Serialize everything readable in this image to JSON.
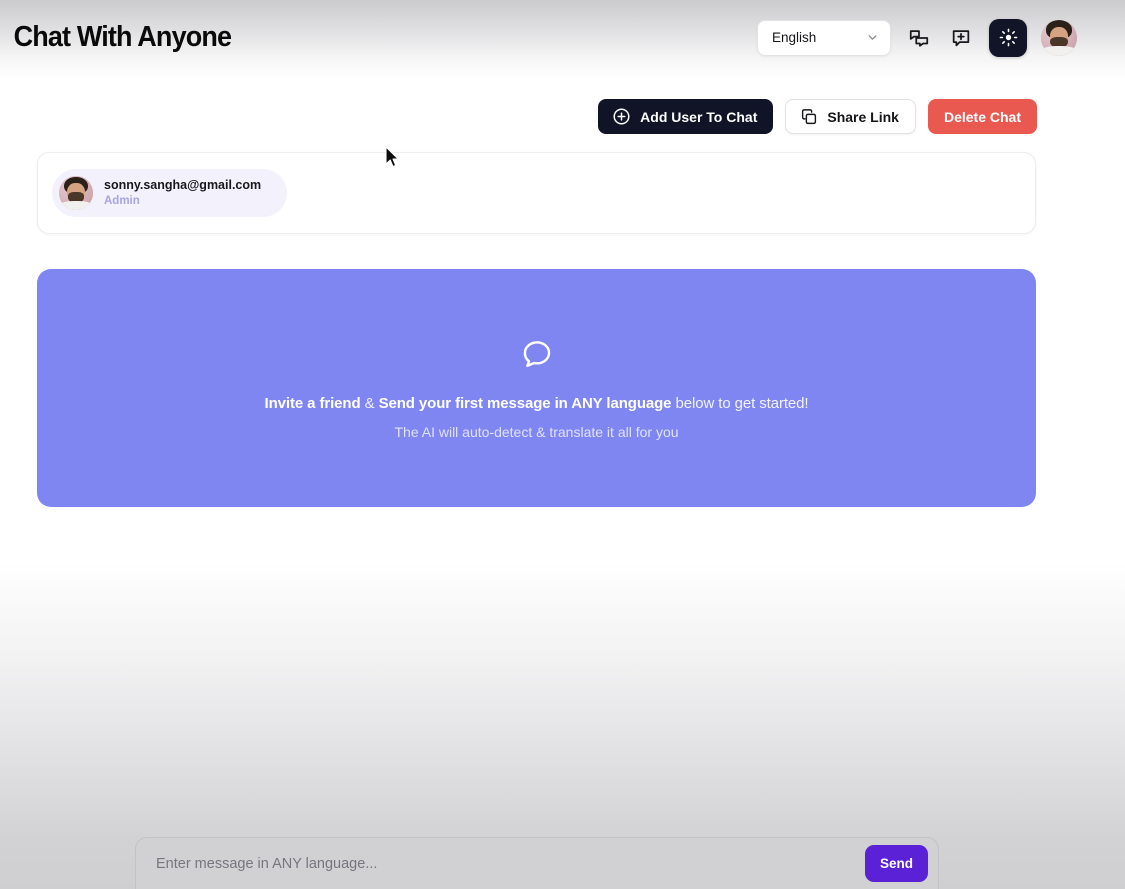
{
  "header": {
    "brand": "Chat With Anyone",
    "language_select": {
      "value": "English",
      "icon": "chevron-down-icon"
    },
    "icons": {
      "chats": "chats-icon",
      "new_chat": "new-chat-icon",
      "theme_toggle": "sun-icon",
      "avatar": "user-avatar"
    }
  },
  "actions": {
    "add_user": {
      "label": "Add User To Chat",
      "icon": "plus-circle-icon"
    },
    "share_link": {
      "label": "Share Link",
      "icon": "copy-icon"
    },
    "delete_chat": {
      "label": "Delete Chat"
    }
  },
  "members": [
    {
      "email": "sonny.sangha@gmail.com",
      "role": "Admin",
      "avatar": "member-avatar"
    }
  ],
  "banner": {
    "icon": "speech-bubble-icon",
    "line1_bold_a": "Invite a friend",
    "line1_amp": " & ",
    "line1_bold_b": "Send your first message in ANY language",
    "line1_normal": " below to get started!",
    "line2": "The AI will auto-detect & translate it all for you"
  },
  "composer": {
    "placeholder": "Enter message in ANY language...",
    "value": "",
    "send_label": "Send"
  },
  "colors": {
    "banner_purple": "#7f86f2",
    "send_purple": "#5b21d6",
    "danger_red": "#e95950",
    "dark_navy": "#101426",
    "role_indigo": "#a9a3e6",
    "chip_lavender": "#f3f1fb"
  }
}
